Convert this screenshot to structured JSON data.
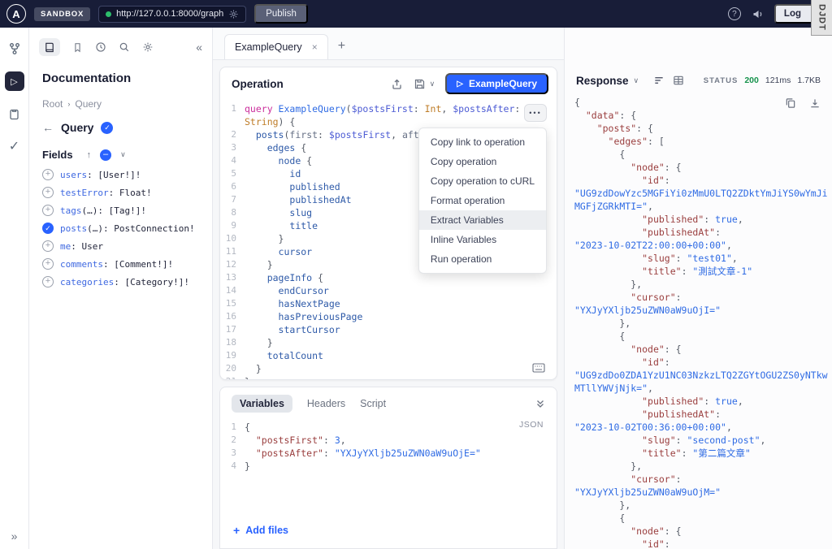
{
  "topbar": {
    "logo_letter": "A",
    "sandbox_label": "SANDBOX",
    "url": "http://127.0.0.1:8000/graph",
    "publish_label": "Publish",
    "login_label": "Log",
    "djdt_label": "DJDT",
    "colors": {
      "bar": "#181D38",
      "accent": "#2962FF",
      "status_green": "#17934D",
      "server_dot_green": "#2DBE6C"
    }
  },
  "docs": {
    "title": "Documentation",
    "breadcrumb": {
      "root": "Root",
      "current": "Query"
    },
    "type_name": "Query",
    "fields_label": "Fields",
    "fields": [
      {
        "name": "users",
        "args": "",
        "rest": ": [User!]!",
        "selected": false
      },
      {
        "name": "testError",
        "args": "",
        "rest": ": Float!",
        "selected": false
      },
      {
        "name": "tags",
        "args": "(…)",
        "rest": ": [Tag!]!",
        "selected": false
      },
      {
        "name": "posts",
        "args": "(…)",
        "rest": ": PostConnection!",
        "selected": true
      },
      {
        "name": "me",
        "args": "",
        "rest": ": User",
        "selected": false
      },
      {
        "name": "comments",
        "args": "",
        "rest": ": [Comment!]!",
        "selected": false
      },
      {
        "name": "categories",
        "args": "",
        "rest": ": [Category!]!",
        "selected": false
      }
    ]
  },
  "tabs": {
    "active_label": "ExampleQuery"
  },
  "operation": {
    "title": "Operation",
    "run_label": "ExampleQuery",
    "menu": {
      "items": [
        "Copy link to operation",
        "Copy operation",
        "Copy operation to cURL",
        "Format operation",
        "Extract Variables",
        "Inline Variables",
        "Run operation"
      ],
      "selected": "Extract Variables"
    },
    "rows": [
      {
        "n": "1",
        "tk": [
          [
            "kw",
            "query "
          ],
          [
            "nm",
            "ExampleQuery"
          ],
          [
            "pn",
            "("
          ],
          [
            "vr",
            "$postsFirst"
          ],
          [
            "pn",
            ": "
          ],
          [
            "ty",
            "Int"
          ],
          [
            "pn",
            ", "
          ],
          [
            "vr",
            "$postsAfter"
          ],
          [
            "pn",
            ":"
          ]
        ]
      },
      {
        "n": "",
        "tk": [
          [
            "ty",
            "String"
          ],
          [
            "pn",
            ") {"
          ]
        ]
      },
      {
        "n": "2",
        "tk": [
          [
            "pn",
            "  "
          ],
          [
            "fl",
            "posts"
          ],
          [
            "pn",
            "("
          ],
          [
            "ag",
            "first"
          ],
          [
            "pn",
            ": "
          ],
          [
            "vr",
            "$postsFirst"
          ],
          [
            "pn",
            ", "
          ],
          [
            "ag",
            "after"
          ],
          [
            "pn",
            ": "
          ],
          [
            "vr",
            "$postsAfter"
          ],
          [
            "pn",
            ") {"
          ]
        ]
      },
      {
        "n": "3",
        "tk": [
          [
            "pn",
            "    "
          ],
          [
            "fl",
            "edges"
          ],
          [
            "pn",
            " {"
          ]
        ]
      },
      {
        "n": "4",
        "tk": [
          [
            "pn",
            "      "
          ],
          [
            "fl",
            "node"
          ],
          [
            "pn",
            " {"
          ]
        ]
      },
      {
        "n": "5",
        "tk": [
          [
            "pn",
            "        "
          ],
          [
            "fl",
            "id"
          ]
        ]
      },
      {
        "n": "6",
        "tk": [
          [
            "pn",
            "        "
          ],
          [
            "fl",
            "published"
          ]
        ]
      },
      {
        "n": "7",
        "tk": [
          [
            "pn",
            "        "
          ],
          [
            "fl",
            "publishedAt"
          ]
        ]
      },
      {
        "n": "8",
        "tk": [
          [
            "pn",
            "        "
          ],
          [
            "fl",
            "slug"
          ]
        ]
      },
      {
        "n": "9",
        "tk": [
          [
            "pn",
            "        "
          ],
          [
            "fl",
            "title"
          ]
        ]
      },
      {
        "n": "10",
        "tk": [
          [
            "pn",
            "      }"
          ]
        ]
      },
      {
        "n": "11",
        "tk": [
          [
            "pn",
            "      "
          ],
          [
            "fl",
            "cursor"
          ]
        ]
      },
      {
        "n": "12",
        "tk": [
          [
            "pn",
            "    }"
          ]
        ]
      },
      {
        "n": "13",
        "tk": [
          [
            "pn",
            "    "
          ],
          [
            "fl",
            "pageInfo"
          ],
          [
            "pn",
            " {"
          ]
        ]
      },
      {
        "n": "14",
        "tk": [
          [
            "pn",
            "      "
          ],
          [
            "fl",
            "endCursor"
          ]
        ]
      },
      {
        "n": "15",
        "tk": [
          [
            "pn",
            "      "
          ],
          [
            "fl",
            "hasNextPage"
          ]
        ]
      },
      {
        "n": "16",
        "tk": [
          [
            "pn",
            "      "
          ],
          [
            "fl",
            "hasPreviousPage"
          ]
        ]
      },
      {
        "n": "17",
        "tk": [
          [
            "pn",
            "      "
          ],
          [
            "fl",
            "startCursor"
          ]
        ]
      },
      {
        "n": "18",
        "tk": [
          [
            "pn",
            "    }"
          ]
        ]
      },
      {
        "n": "19",
        "tk": [
          [
            "pn",
            "    "
          ],
          [
            "fl",
            "totalCount"
          ]
        ]
      },
      {
        "n": "20",
        "tk": [
          [
            "pn",
            "  }"
          ]
        ]
      },
      {
        "n": "21",
        "tk": [
          [
            "pn",
            "}"
          ]
        ]
      }
    ]
  },
  "variables": {
    "tab_labels": [
      "Variables",
      "Headers",
      "Script"
    ],
    "active_tab": "Variables",
    "mode_label": "JSON",
    "add_files_label": "Add files",
    "rows": [
      {
        "n": "1",
        "tk": [
          [
            "pn",
            "{"
          ]
        ]
      },
      {
        "n": "2",
        "tk": [
          [
            "pn",
            "  "
          ],
          [
            "ky",
            "\"postsFirst\""
          ],
          [
            "pn",
            ": "
          ],
          [
            "nb",
            "3"
          ],
          [
            "pn",
            ","
          ]
        ]
      },
      {
        "n": "3",
        "tk": [
          [
            "pn",
            "  "
          ],
          [
            "ky",
            "\"postsAfter\""
          ],
          [
            "pn",
            ": "
          ],
          [
            "st",
            "\"YXJyYXljb25uZWN0aW9uOjE=\""
          ]
        ]
      },
      {
        "n": "4",
        "tk": [
          [
            "pn",
            "}"
          ]
        ]
      }
    ]
  },
  "response": {
    "title": "Response",
    "status_label": "STATUS",
    "status_code": "200",
    "duration": "121ms",
    "size": "1.7KB",
    "rows": [
      {
        "tk": [
          [
            "pn",
            "{"
          ]
        ]
      },
      {
        "tk": [
          [
            "pn",
            "  "
          ],
          [
            "ky",
            "\"data\""
          ],
          [
            "pn",
            ": {"
          ]
        ]
      },
      {
        "tk": [
          [
            "pn",
            "    "
          ],
          [
            "ky",
            "\"posts\""
          ],
          [
            "pn",
            ": {"
          ]
        ]
      },
      {
        "tk": [
          [
            "pn",
            "      "
          ],
          [
            "ky",
            "\"edges\""
          ],
          [
            "pn",
            ": ["
          ]
        ]
      },
      {
        "tk": [
          [
            "pn",
            "        {"
          ]
        ]
      },
      {
        "tk": [
          [
            "pn",
            "          "
          ],
          [
            "ky",
            "\"node\""
          ],
          [
            "pn",
            ": {"
          ]
        ]
      },
      {
        "tk": [
          [
            "pn",
            "            "
          ],
          [
            "ky",
            "\"id\""
          ],
          [
            "pn",
            ":"
          ]
        ]
      },
      {
        "tk": [
          [
            "st",
            "\"UG9zdDowYzc5MGFiYi0zMmU0LTQ2ZDktYmJiYS0wYmJi"
          ]
        ]
      },
      {
        "tk": [
          [
            "st",
            "MGFjZGRkMTI=\""
          ],
          [
            "pn",
            ","
          ]
        ]
      },
      {
        "tk": [
          [
            "pn",
            "            "
          ],
          [
            "ky",
            "\"published\""
          ],
          [
            "pn",
            ": "
          ],
          [
            "bl",
            "true"
          ],
          [
            "pn",
            ","
          ]
        ]
      },
      {
        "tk": [
          [
            "pn",
            "            "
          ],
          [
            "ky",
            "\"publishedAt\""
          ],
          [
            "pn",
            ":"
          ]
        ]
      },
      {
        "tk": [
          [
            "st",
            "\"2023-10-02T22:00:00+00:00\""
          ],
          [
            "pn",
            ","
          ]
        ]
      },
      {
        "tk": [
          [
            "pn",
            "            "
          ],
          [
            "ky",
            "\"slug\""
          ],
          [
            "pn",
            ": "
          ],
          [
            "st",
            "\"test01\""
          ],
          [
            "pn",
            ","
          ]
        ]
      },
      {
        "tk": [
          [
            "pn",
            "            "
          ],
          [
            "ky",
            "\"title\""
          ],
          [
            "pn",
            ": "
          ],
          [
            "st",
            "\"測試文章-1\""
          ]
        ]
      },
      {
        "tk": [
          [
            "pn",
            "          },"
          ]
        ]
      },
      {
        "tk": [
          [
            "pn",
            "          "
          ],
          [
            "ky",
            "\"cursor\""
          ],
          [
            "pn",
            ":"
          ]
        ]
      },
      {
        "tk": [
          [
            "st",
            "\"YXJyYXljb25uZWN0aW9uOjI=\""
          ]
        ]
      },
      {
        "tk": [
          [
            "pn",
            "        },"
          ]
        ]
      },
      {
        "tk": [
          [
            "pn",
            "        {"
          ]
        ]
      },
      {
        "tk": [
          [
            "pn",
            "          "
          ],
          [
            "ky",
            "\"node\""
          ],
          [
            "pn",
            ": {"
          ]
        ]
      },
      {
        "tk": [
          [
            "pn",
            "            "
          ],
          [
            "ky",
            "\"id\""
          ],
          [
            "pn",
            ":"
          ]
        ]
      },
      {
        "tk": [
          [
            "st",
            "\"UG9zdDo0ZDA1YzU1NC03NzkzLTQ2ZGYtOGU2ZS0yNTkw"
          ]
        ]
      },
      {
        "tk": [
          [
            "st",
            "MTllYWVjNjk=\""
          ],
          [
            "pn",
            ","
          ]
        ]
      },
      {
        "tk": [
          [
            "pn",
            "            "
          ],
          [
            "ky",
            "\"published\""
          ],
          [
            "pn",
            ": "
          ],
          [
            "bl",
            "true"
          ],
          [
            "pn",
            ","
          ]
        ]
      },
      {
        "tk": [
          [
            "pn",
            "            "
          ],
          [
            "ky",
            "\"publishedAt\""
          ],
          [
            "pn",
            ":"
          ]
        ]
      },
      {
        "tk": [
          [
            "st",
            "\"2023-10-02T00:36:00+00:00\""
          ],
          [
            "pn",
            ","
          ]
        ]
      },
      {
        "tk": [
          [
            "pn",
            "            "
          ],
          [
            "ky",
            "\"slug\""
          ],
          [
            "pn",
            ": "
          ],
          [
            "st",
            "\"second-post\""
          ],
          [
            "pn",
            ","
          ]
        ]
      },
      {
        "tk": [
          [
            "pn",
            "            "
          ],
          [
            "ky",
            "\"title\""
          ],
          [
            "pn",
            ": "
          ],
          [
            "st",
            "\"第二篇文章\""
          ]
        ]
      },
      {
        "tk": [
          [
            "pn",
            "          },"
          ]
        ]
      },
      {
        "tk": [
          [
            "pn",
            "          "
          ],
          [
            "ky",
            "\"cursor\""
          ],
          [
            "pn",
            ":"
          ]
        ]
      },
      {
        "tk": [
          [
            "st",
            "\"YXJyYXljb25uZWN0aW9uOjM=\""
          ]
        ]
      },
      {
        "tk": [
          [
            "pn",
            "        },"
          ]
        ]
      },
      {
        "tk": [
          [
            "pn",
            "        {"
          ]
        ]
      },
      {
        "tk": [
          [
            "pn",
            "          "
          ],
          [
            "ky",
            "\"node\""
          ],
          [
            "pn",
            ": {"
          ]
        ]
      },
      {
        "tk": [
          [
            "pn",
            "            "
          ],
          [
            "ky",
            "\"id\""
          ],
          [
            "pn",
            ":"
          ]
        ]
      }
    ]
  }
}
